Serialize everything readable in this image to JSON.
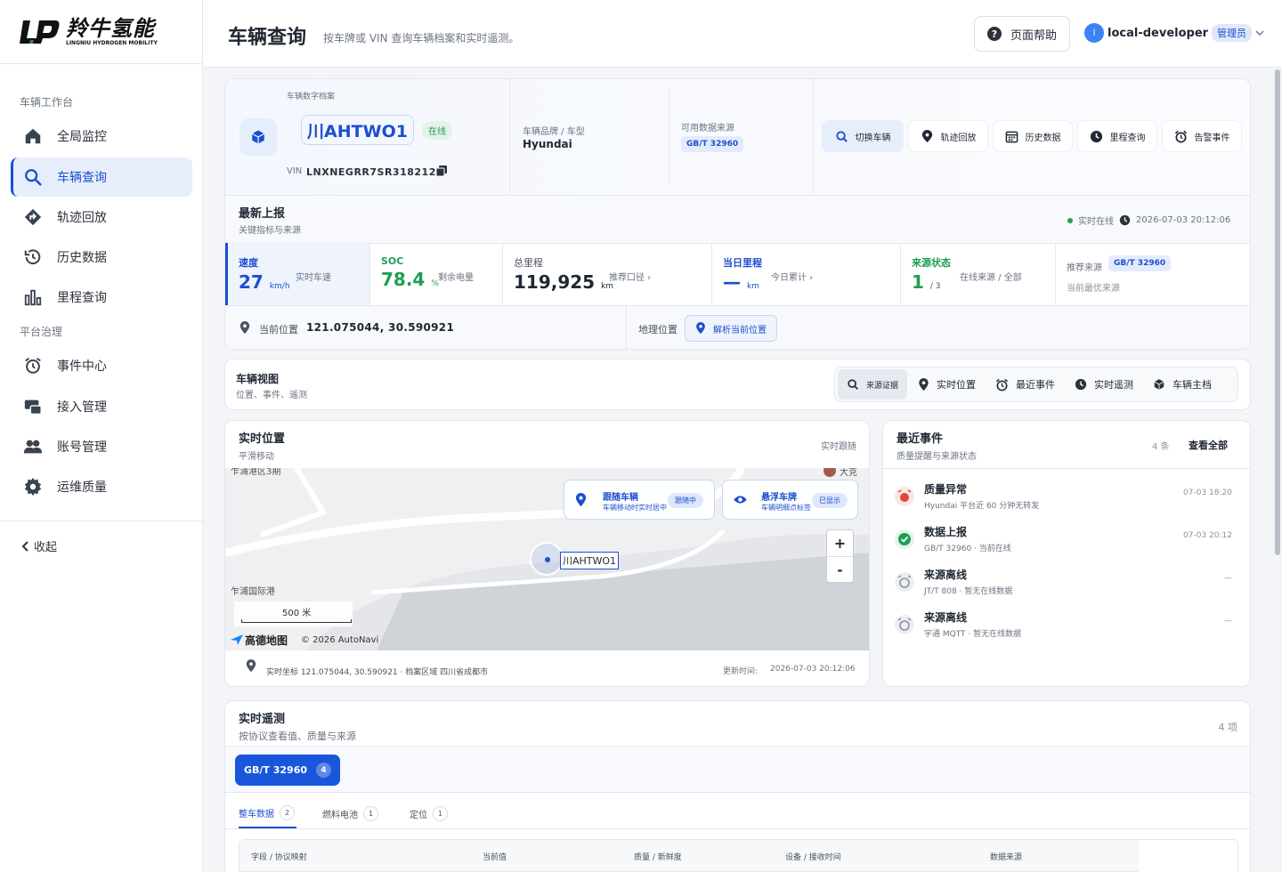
{
  "brand": {
    "name_cn": "羚牛氢能",
    "name_en": "LINGNIU HYDROGEN MOBILITY"
  },
  "sidebar": {
    "group_workbench": "车辆工作台",
    "group_platform": "平台治理",
    "items": [
      {
        "label": "全局监控",
        "icon": "home-icon"
      },
      {
        "label": "车辆查询",
        "icon": "search-icon"
      },
      {
        "label": "轨迹回放",
        "icon": "route-icon"
      },
      {
        "label": "历史数据",
        "icon": "history-icon"
      },
      {
        "label": "里程查询",
        "icon": "bar-chart-icon"
      },
      {
        "label": "事件中心",
        "icon": "alarm-icon"
      },
      {
        "label": "接入管理",
        "icon": "access-icon"
      },
      {
        "label": "账号管理",
        "icon": "users-icon"
      },
      {
        "label": "运维质量",
        "icon": "gear-icon"
      }
    ],
    "collapse": "收起"
  },
  "header": {
    "title": "车辆查询",
    "subtitle": "按车牌或 VIN 查询车辆档案和实时遥测。",
    "help": "页面帮助",
    "avatar": "l",
    "user": "local-developer",
    "role": "管理员"
  },
  "vehicle": {
    "archive_label": "车辆数字档案",
    "plate": "川AHTWO1",
    "status": "在线",
    "vin_label": "VIN",
    "vin": "LNXNEGRR7SR318212",
    "brand_label": "车辆品牌 / 车型",
    "brand": "Hyundai",
    "source_label": "可用数据来源",
    "source": "GB/T 32960"
  },
  "actions": [
    "切换车辆",
    "轨迹回放",
    "历史数据",
    "里程查询",
    "告警事件"
  ],
  "latest": {
    "title": "最新上报",
    "subtitle": "关键指标与来源",
    "realtime": "实时在线",
    "time": "2026-07-03 20:12:06"
  },
  "metrics": {
    "speed": {
      "label": "速度",
      "value": "27",
      "unit": "km/h",
      "side": "实时车速"
    },
    "soc": {
      "label": "SOC",
      "value": "78.4",
      "unit": "%",
      "side": "剩余电量"
    },
    "odometer": {
      "label": "总里程",
      "value": "119,925",
      "unit": "km",
      "side": "推荐口径 ›"
    },
    "today": {
      "label": "当日里程",
      "value": "—",
      "unit": "km",
      "side": "今日累计 ›"
    },
    "source_status": {
      "label": "来源状态",
      "value": "1",
      "unit": "/ 3",
      "side": "在线来源 / 全部"
    },
    "recommend": {
      "label": "推荐来源",
      "value": "GB/T 32960",
      "side": "当前最优来源"
    }
  },
  "location": {
    "label": "当前位置",
    "coords": "121.075044, 30.590921",
    "geo_label": "地理位置",
    "resolve": "解析当前位置"
  },
  "view": {
    "title": "车辆视图",
    "subtitle": "位置、事件、遥测",
    "tabs": [
      "来源证据",
      "实时位置",
      "最近事件",
      "实时遥测",
      "车辆主档"
    ]
  },
  "map": {
    "title": "实时位置",
    "subtitle": "平滑移动",
    "follow_text": "实时跟随",
    "card1_title": "跟随车辆",
    "card1_sub": "车辆移动时实时居中",
    "card1_tag": "跟随中",
    "card2_title": "悬浮车牌",
    "card2_sub": "车辆明细点标签",
    "card2_tag": "已显示",
    "place1": "乍浦港区3期",
    "place2": "乍浦国际港",
    "place3": "大克",
    "plate_label": "川AHTWO1",
    "scale": "500 米",
    "map_brand": "高德地图",
    "copyright": "© 2026 AutoNavi",
    "footer_coords": "实时坐标 121.075044, 30.590921 · 档案区域 四川省成都市",
    "footer_update_label": "更新时间:",
    "footer_update": "2026-07-03 20:12:06",
    "zoom_in": "+",
    "zoom_out": "-"
  },
  "events": {
    "title": "最近事件",
    "subtitle": "质量提醒与来源状态",
    "count": "4 条",
    "view_all": "查看全部",
    "items": [
      {
        "title": "质量异常",
        "desc": "Hyundai 平台近 60 分钟无转发",
        "time": "07-03 18:20",
        "color": "#e0463c"
      },
      {
        "title": "数据上报",
        "desc": "GB/T 32960 · 当前在线",
        "time": "07-03 20:12",
        "color": "#1f9d55"
      },
      {
        "title": "来源离线",
        "desc": "JT/T 808 · 暂无在线数据",
        "time": "—",
        "color": "#8a93a0"
      },
      {
        "title": "来源离线",
        "desc": "宇通 MQTT · 暂无在线数据",
        "time": "—",
        "color": "#8a93a0"
      }
    ]
  },
  "telemetry": {
    "title": "实时遥测",
    "subtitle": "按协议查看值、质量与来源",
    "count": "4 项",
    "protocol": "GB/T 32960",
    "protocol_count": "4",
    "subtabs": [
      {
        "label": "整车数据",
        "count": "2"
      },
      {
        "label": "燃料电池",
        "count": "1"
      },
      {
        "label": "定位",
        "count": "1"
      }
    ],
    "columns": [
      "字段 / 协议映射",
      "当前值",
      "质量 / 新鲜度",
      "设备 / 接收时间",
      "数据来源"
    ]
  },
  "colors": {
    "accent": "#1c4fcf",
    "primary_btn": "#1a56db",
    "success": "#1f9d55",
    "danger": "#e0463c"
  }
}
